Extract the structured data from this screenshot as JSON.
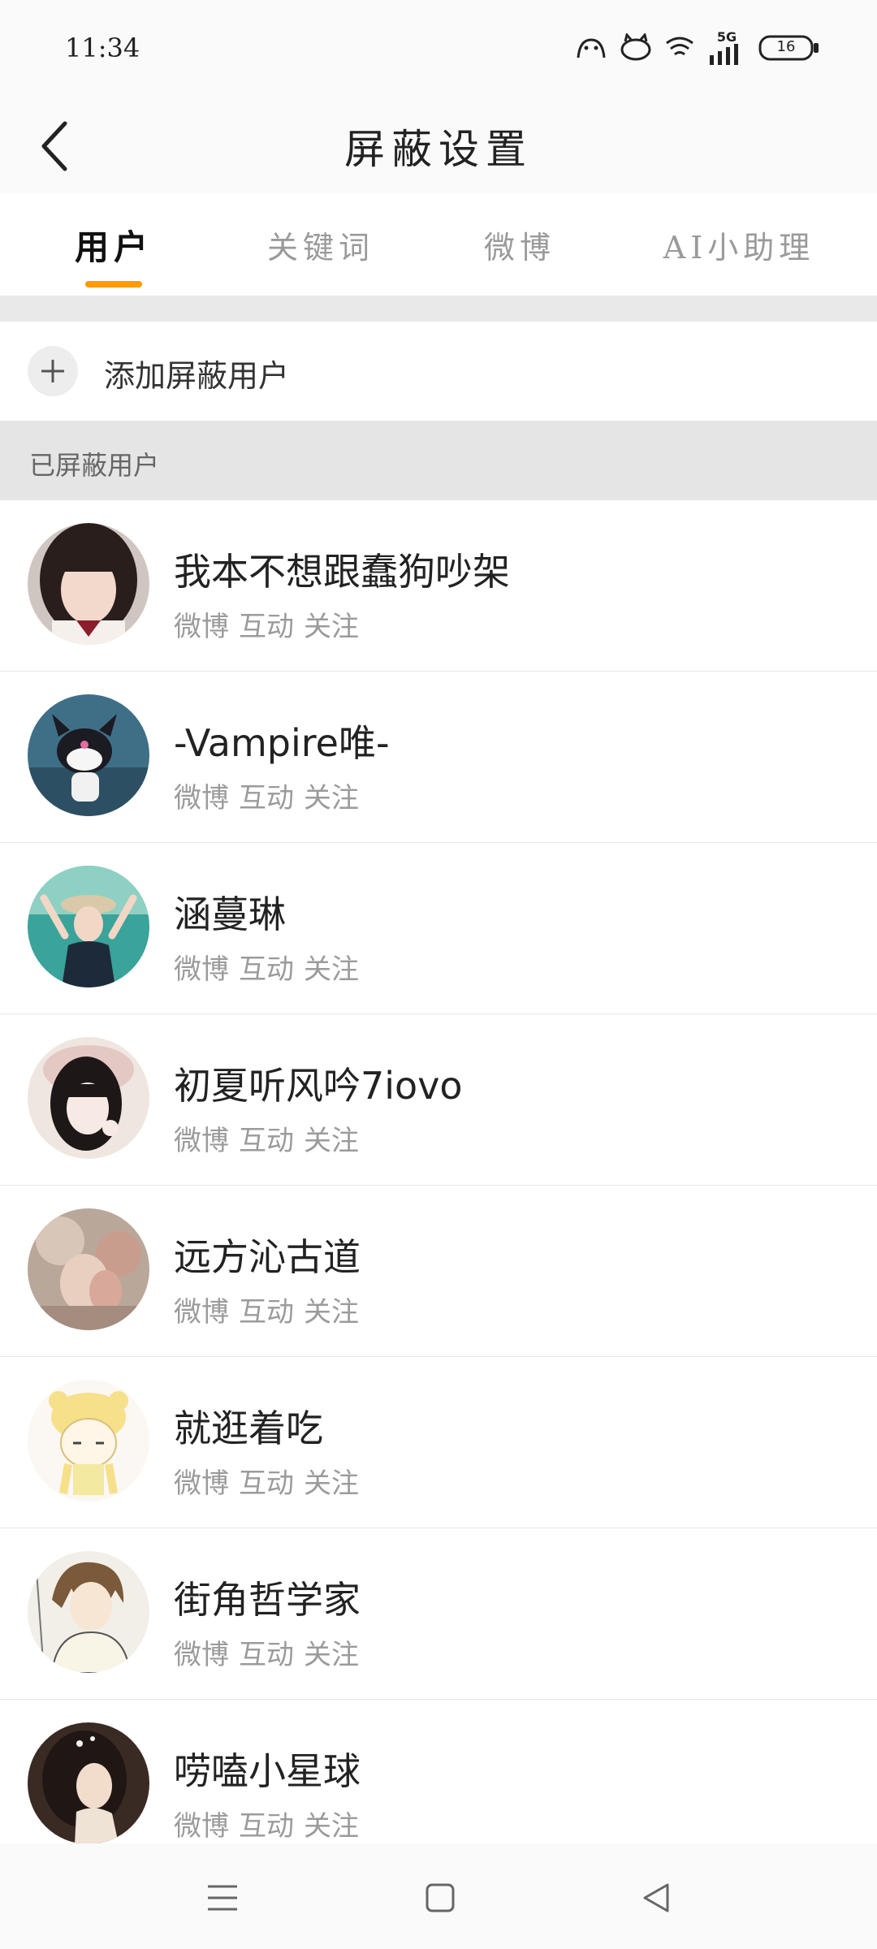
{
  "status_bar": {
    "time": "11:34",
    "network": "5G",
    "battery": "16"
  },
  "header": {
    "title": "屏蔽设置"
  },
  "tabs": [
    {
      "label": "用户",
      "active": true
    },
    {
      "label": "关键词",
      "active": false
    },
    {
      "label": "微博",
      "active": false
    },
    {
      "label": "AI小助理",
      "active": false
    }
  ],
  "add_row": {
    "label": "添加屏蔽用户"
  },
  "section": {
    "title": "已屏蔽用户"
  },
  "users": [
    {
      "name": "我本不想跟蠢狗吵架",
      "actions": [
        "微博",
        "互动",
        "关注"
      ]
    },
    {
      "name": "-Vampire唯-",
      "actions": [
        "微博",
        "互动",
        "关注"
      ]
    },
    {
      "name": "涵蔓琳",
      "actions": [
        "微博",
        "互动",
        "关注"
      ]
    },
    {
      "name": "初夏听风吟7iovo",
      "actions": [
        "微博",
        "互动",
        "关注"
      ]
    },
    {
      "name": "远方沁古道",
      "actions": [
        "微博",
        "互动",
        "关注"
      ]
    },
    {
      "name": "就逛着吃",
      "actions": [
        "微博",
        "互动",
        "关注"
      ]
    },
    {
      "name": "街角哲学家",
      "actions": [
        "微博",
        "互动",
        "关注"
      ]
    },
    {
      "name": "唠嗑小星球",
      "actions": [
        "微博",
        "互动",
        "关注"
      ]
    }
  ],
  "icons": {
    "back": "chevron-left-icon",
    "add": "plus-icon",
    "nav_menu": "menu-icon",
    "nav_home": "home-square-icon",
    "nav_back": "triangle-back-icon"
  },
  "colors": {
    "accent": "#ff9a00",
    "section_bg": "#e5e5e5",
    "secondary_text": "#9b9b9b"
  }
}
